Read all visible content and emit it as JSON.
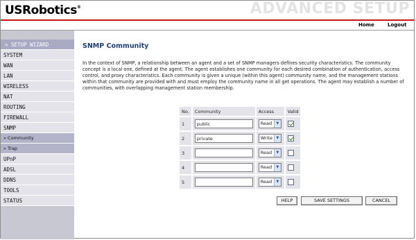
{
  "header": {
    "logo_text": "USRobotics",
    "title": "ADVANCED SETUP"
  },
  "nav": {
    "home": "Home",
    "logout": "Logout"
  },
  "sidebar": {
    "wizard": "» SETUP WIZARD",
    "items": [
      "SYSTEM",
      "WAN",
      "LAN",
      "WIRELESS",
      "NAT",
      "ROUTING",
      "FIREWALL",
      "SNMP"
    ],
    "sub_items": [
      "» Community",
      "» Trap"
    ],
    "items_after": [
      "UPnP",
      "ADSL",
      "DDNS",
      "TOOLS",
      "STATUS"
    ]
  },
  "main": {
    "title": "SNMP Community",
    "description": "In the context of SNMP, a relationship between an agent and a set of SNMP managers defines security characteristics. The community concept is a local one, defined at the agent. The agent establishes one community for each desired combination of authentication, access control, and proxy characteristics. Each community is given a unique (within this agent) community name, and the management stations within that community are provided with and must employ the community name in all get operations. The agent may establish a number of communities, with overlapping management station membership."
  },
  "table": {
    "headers": {
      "no": "No.",
      "community": "Community",
      "access": "Access",
      "valid": "Valid"
    },
    "rows": [
      {
        "no": "1",
        "community": "public",
        "access": "Read",
        "valid": true
      },
      {
        "no": "2",
        "community": "private",
        "access": "Write",
        "valid": true
      },
      {
        "no": "3",
        "community": "",
        "access": "Read",
        "valid": false
      },
      {
        "no": "4",
        "community": "",
        "access": "Read",
        "valid": false
      },
      {
        "no": "5",
        "community": "",
        "access": "Read",
        "valid": false
      }
    ]
  },
  "buttons": {
    "help": "HELP",
    "save": "SAVE SETTINGS",
    "cancel": "CANCEL"
  },
  "colors": {
    "brand_red": "#c8151b",
    "title_blue": "#1d3f77",
    "sidebar_bg": "#c8c8d2"
  }
}
